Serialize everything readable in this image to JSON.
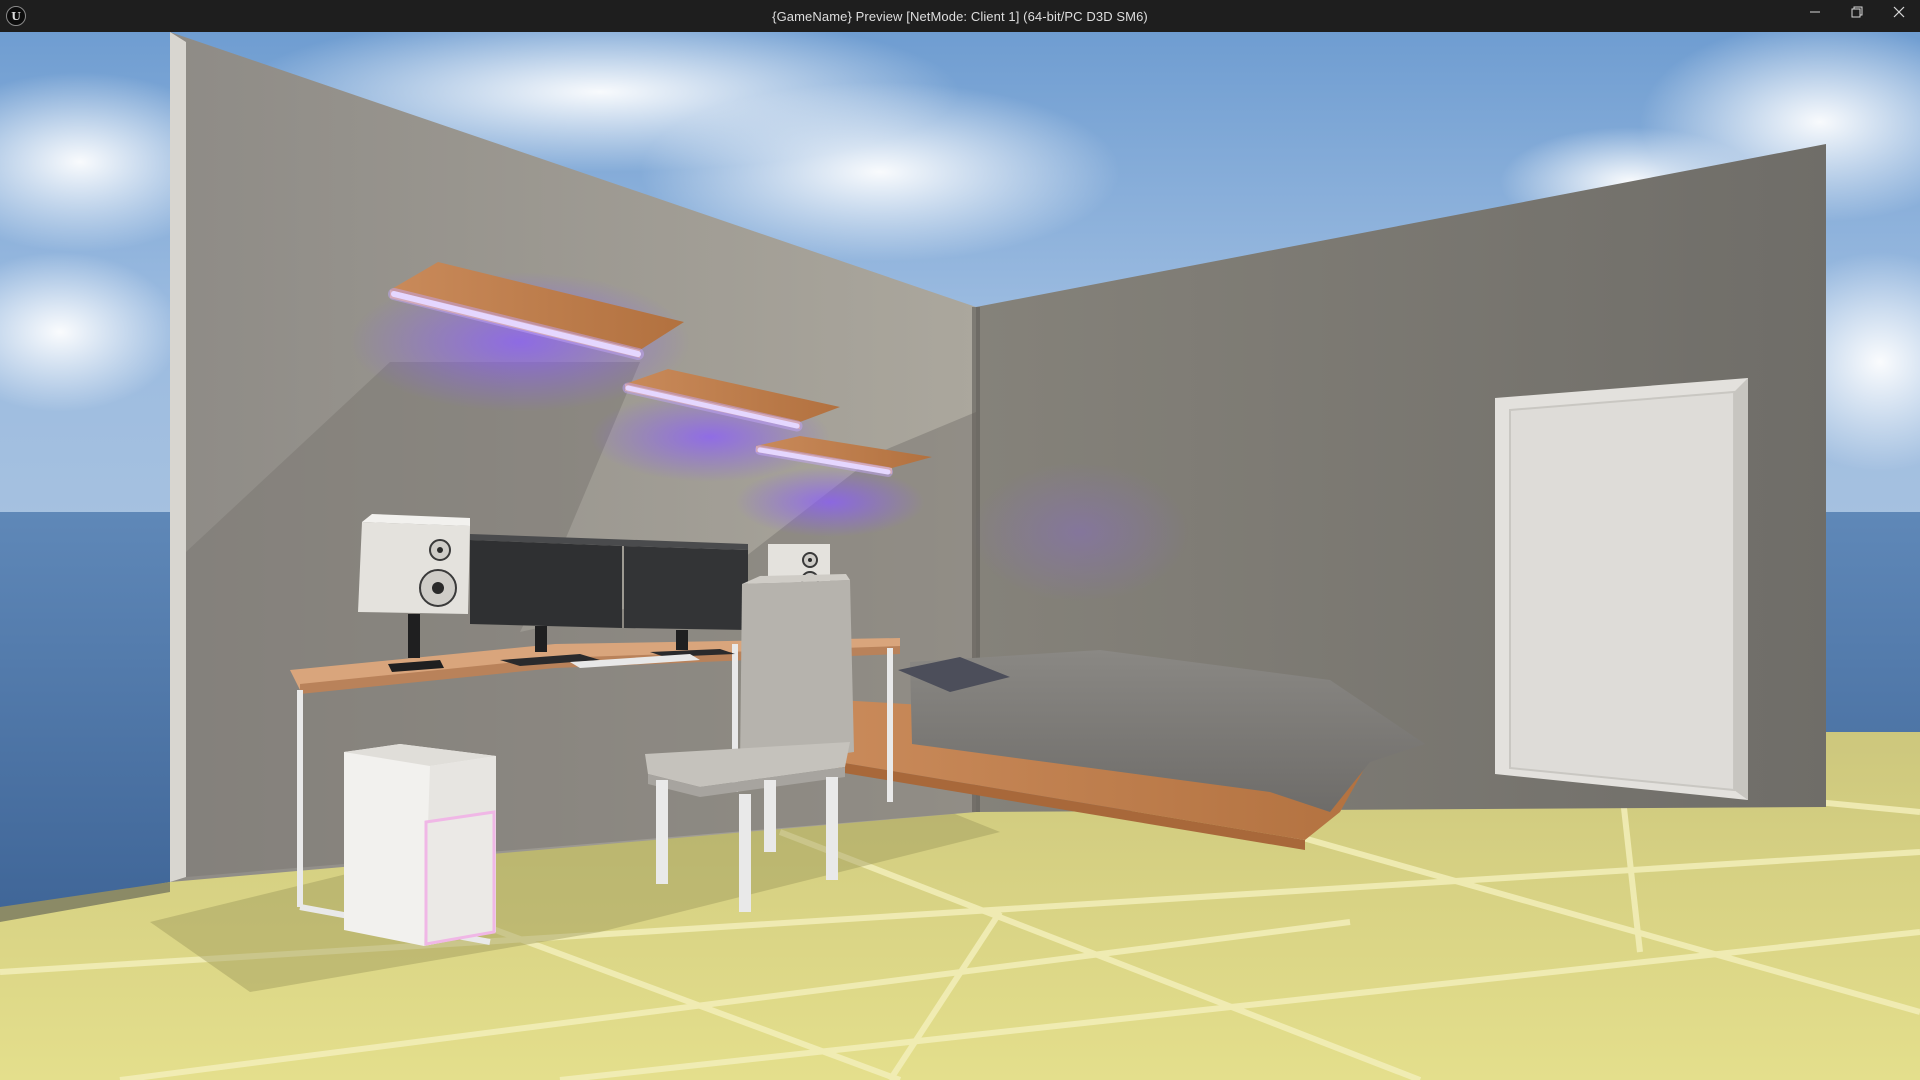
{
  "window": {
    "title": "{GameName} Preview [NetMode: Client 1]  (64-bit/PC D3D SM6)",
    "logo_icon": "unreal-engine-logo-icon",
    "logo_text": "U",
    "buttons": [
      "minimize-icon",
      "restore-icon",
      "close-icon"
    ]
  },
  "scene": {
    "type": "3d-game-viewport",
    "description_objects": [
      "sky",
      "ocean",
      "tiled-floor",
      "left-wall",
      "right-wall",
      "light-shelves",
      "desk",
      "monitors",
      "speakers",
      "pc-tower",
      "chair",
      "bed",
      "door"
    ],
    "colors": {
      "sky_top": "#7fa6d2",
      "wall": "#8a877f",
      "floor": "#d8d58a",
      "neon": "#9f6bff",
      "wood": "#c98a5a"
    }
  }
}
